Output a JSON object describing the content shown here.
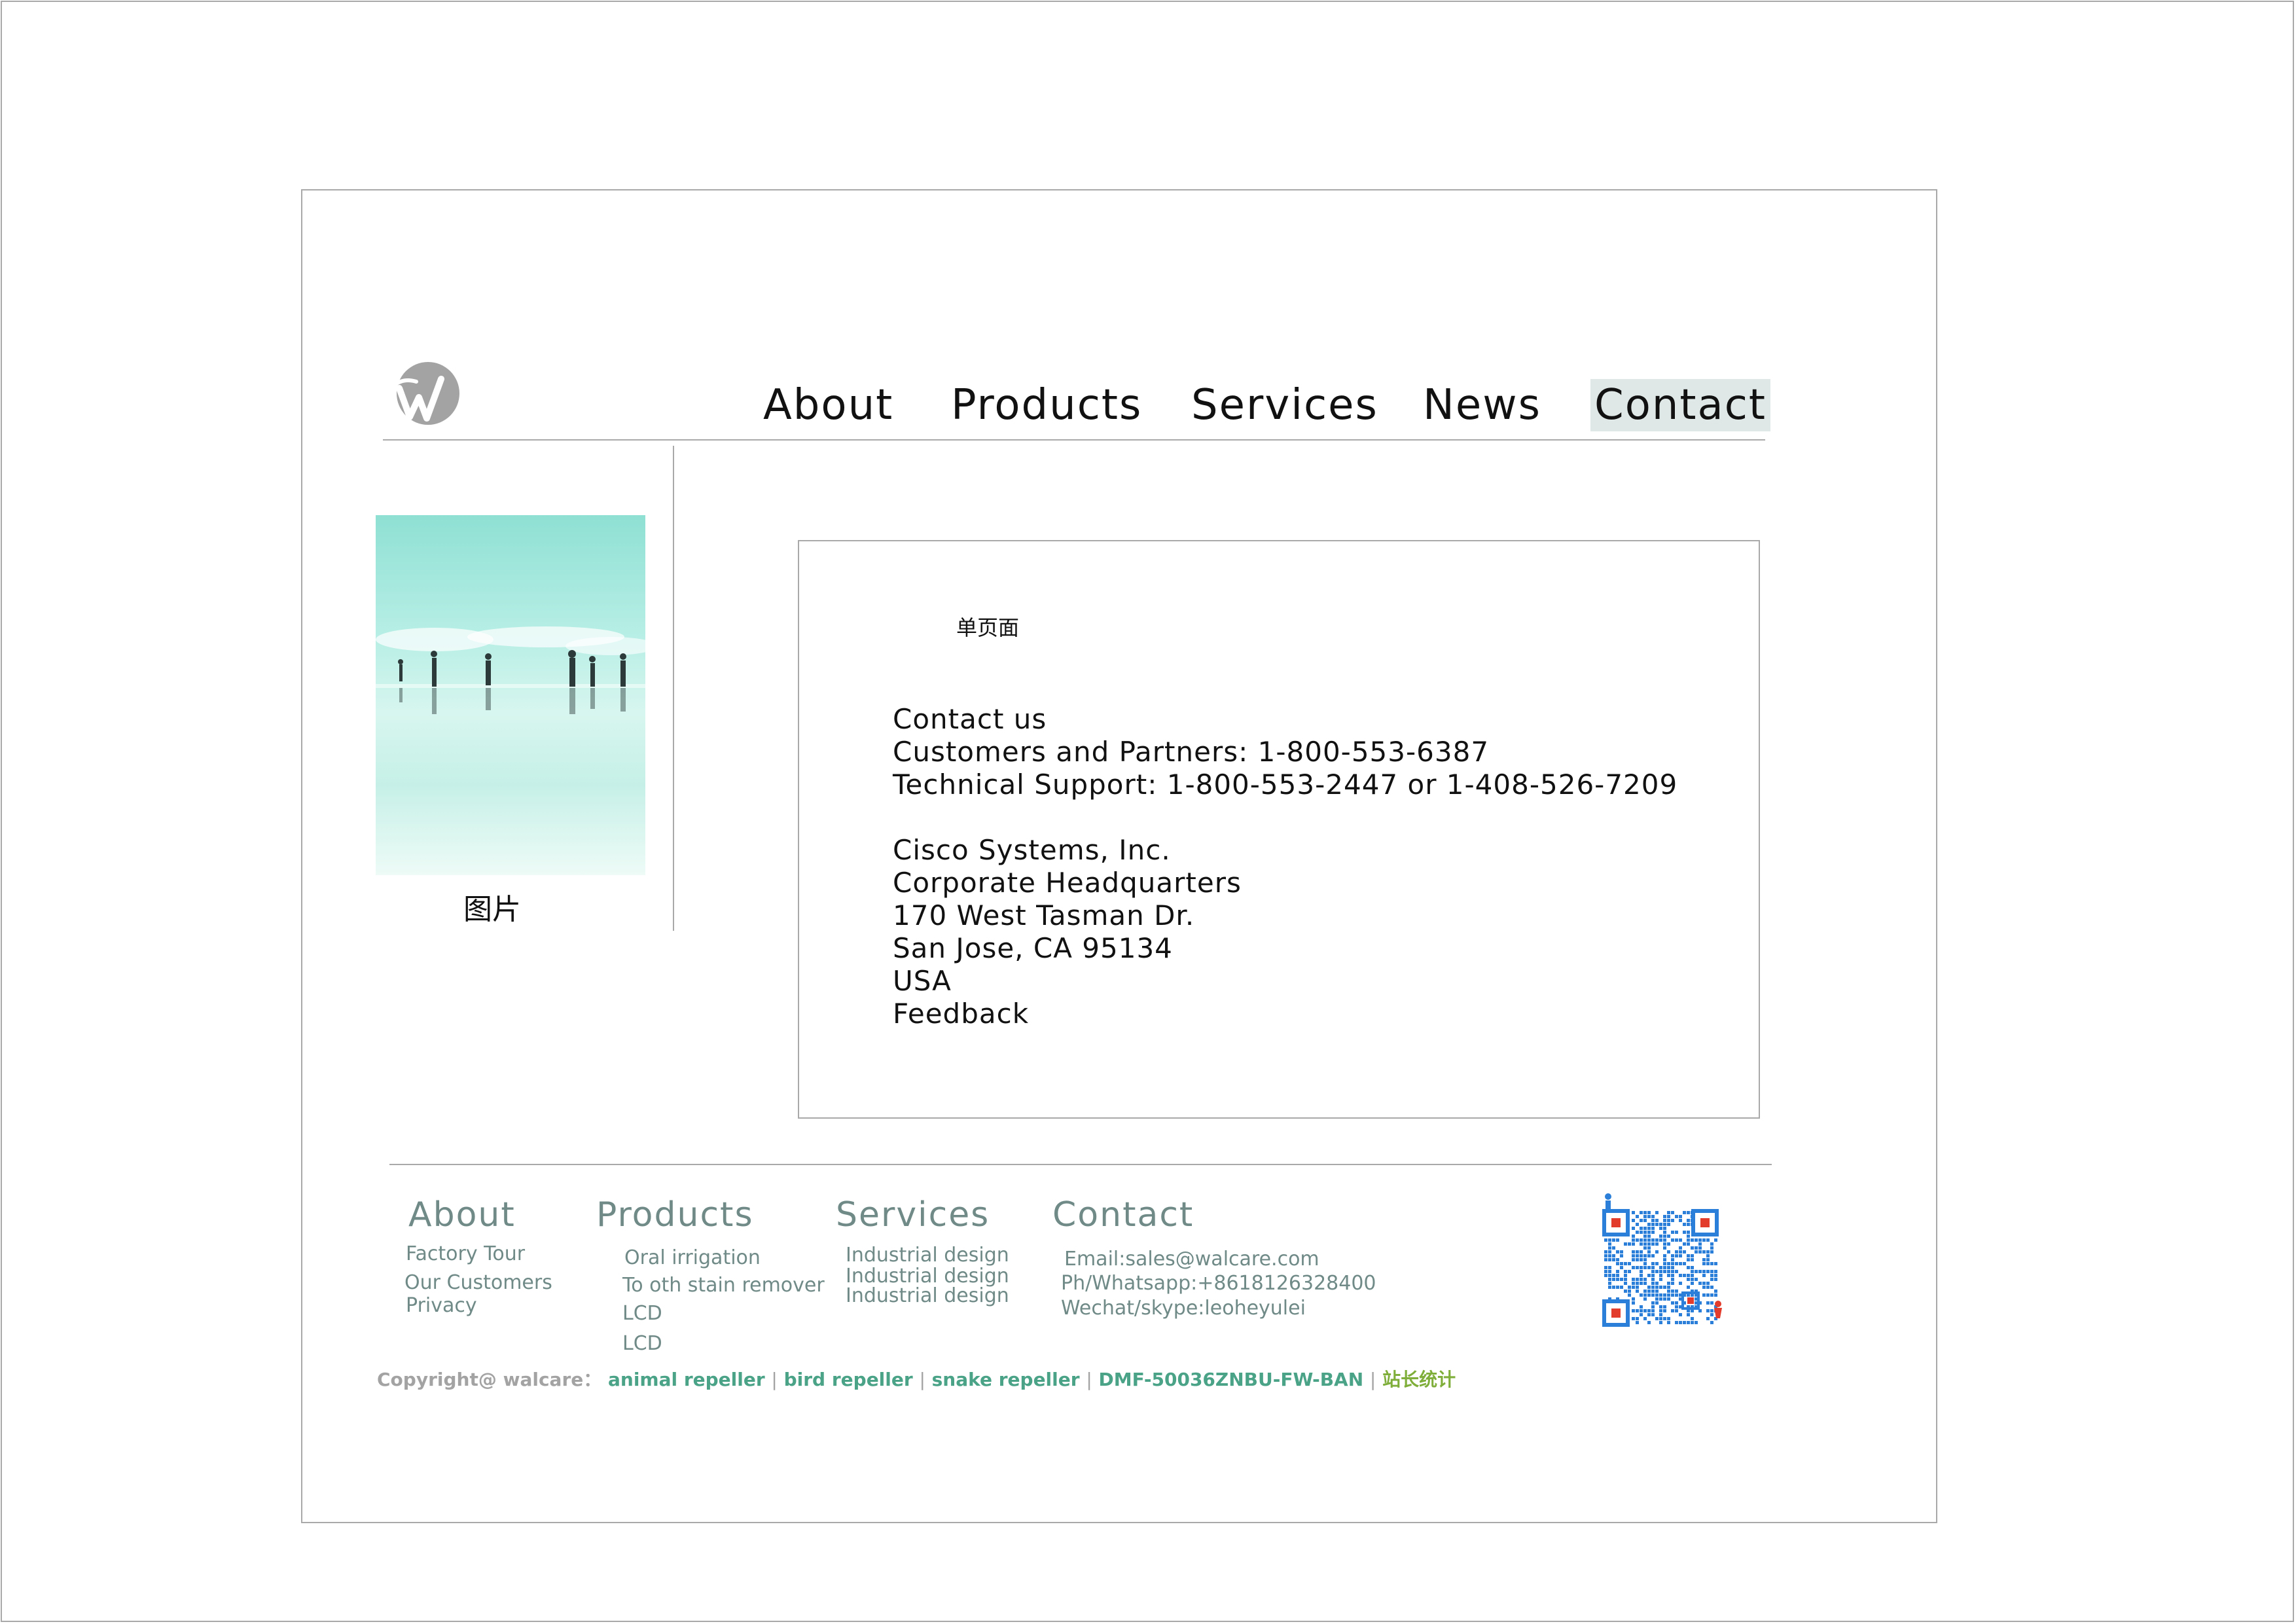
{
  "nav": {
    "items": [
      "About",
      "Products",
      "Services",
      "News",
      "Contact"
    ],
    "active": "Contact"
  },
  "sidebar": {
    "image_caption": "图片"
  },
  "content": {
    "page_label": "单页面",
    "lines": [
      "Contact us",
      "Customers and Partners: 1-800-553-6387",
      "Technical Support: 1-800-553-2447 or 1-408-526-7209",
      "",
      "Cisco Systems, Inc.",
      "Corporate Headquarters",
      "170 West Tasman Dr.",
      "San Jose, CA 95134",
      "USA",
      "Feedback"
    ]
  },
  "footer": {
    "about": {
      "title": "About",
      "items": [
        "Factory Tour",
        "Our Customers",
        "Privacy"
      ]
    },
    "products": {
      "title": "Products",
      "items": [
        "Oral irrigation",
        "To oth stain remover",
        "LCD",
        "LCD"
      ]
    },
    "services": {
      "title": "Services",
      "items": [
        "Industrial design",
        "Industrial design",
        "Industrial design"
      ]
    },
    "contact": {
      "title": "Contact",
      "items": [
        "Email:sales@walcare.com",
        "Ph/Whatsapp:+8618126328400",
        "Wechat/skype:leoheyulei"
      ]
    }
  },
  "copyright": {
    "prefix": "Copyright@ walcare：",
    "links": [
      "animal repeller",
      "bird repeller",
      "snake repeller",
      "DMF-50036ZNBU-FW-BAN"
    ],
    "stats": "站长统计",
    "separator": "|"
  },
  "colors": {
    "border": "#a9a9a9",
    "nav_active_bg": "#dfe8e6",
    "footer_text": "#6f8a87",
    "copyright_gray": "#a3a3a3",
    "copyright_link": "#4aa287",
    "copyright_stats": "#7fae3a"
  },
  "icons": {
    "logo": "walcare-logo",
    "qr": "qr-code-icon"
  }
}
